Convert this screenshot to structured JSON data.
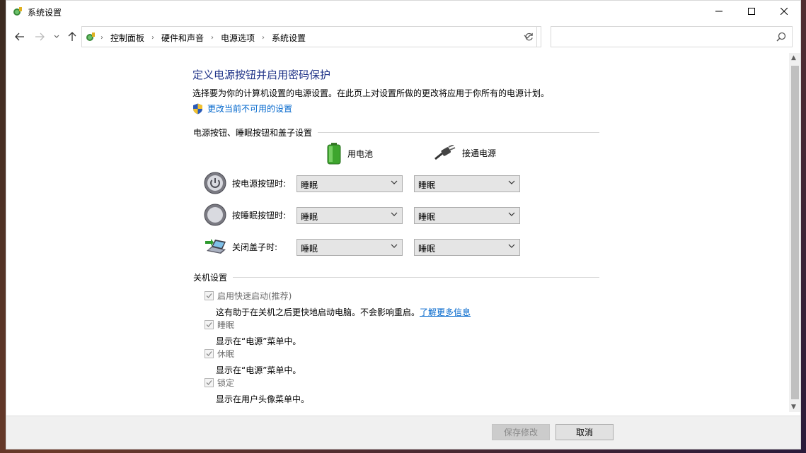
{
  "window": {
    "title": "系统设置"
  },
  "nav": {
    "breadcrumbs": [
      "控制面板",
      "硬件和声音",
      "电源选项",
      "系统设置"
    ],
    "search_placeholder": ""
  },
  "page": {
    "title": "定义电源按钮并启用密码保护",
    "description": "选择要为你的计算机设置的电源设置。在此页上对设置所做的更改将应用于你所有的电源计划。",
    "admin_link": "更改当前不可用的设置"
  },
  "power_buttons": {
    "section_title": "电源按钮、睡眠按钮和盖子设置",
    "columns": {
      "battery": "用电池",
      "plugged": "接通电源"
    },
    "rows": [
      {
        "label": "按电源按钮时:",
        "battery": "睡眠",
        "plugged": "睡眠",
        "icon": "power-button-icon"
      },
      {
        "label": "按睡眠按钮时:",
        "battery": "睡眠",
        "plugged": "睡眠",
        "icon": "sleep-button-icon"
      },
      {
        "label": "关闭盖子时:",
        "battery": "睡眠",
        "plugged": "睡眠",
        "icon": "laptop-lid-icon"
      }
    ]
  },
  "shutdown": {
    "section_title": "关机设置",
    "items": [
      {
        "label": "启用快速启动(推荐)",
        "desc": "这有助于在关机之后更快地启动电脑。不会影响重启。",
        "link": "了解更多信息",
        "checked": true
      },
      {
        "label": "睡眠",
        "desc": "显示在“电源”菜单中。",
        "checked": true
      },
      {
        "label": "休眠",
        "desc": "显示在“电源”菜单中。",
        "checked": true
      },
      {
        "label": "锁定",
        "desc": "显示在用户头像菜单中。",
        "checked": true
      }
    ]
  },
  "footer": {
    "save_label": "保存修改",
    "cancel_label": "取消"
  },
  "colors": {
    "title_blue": "#1e3287",
    "link_blue": "#0066cc"
  }
}
